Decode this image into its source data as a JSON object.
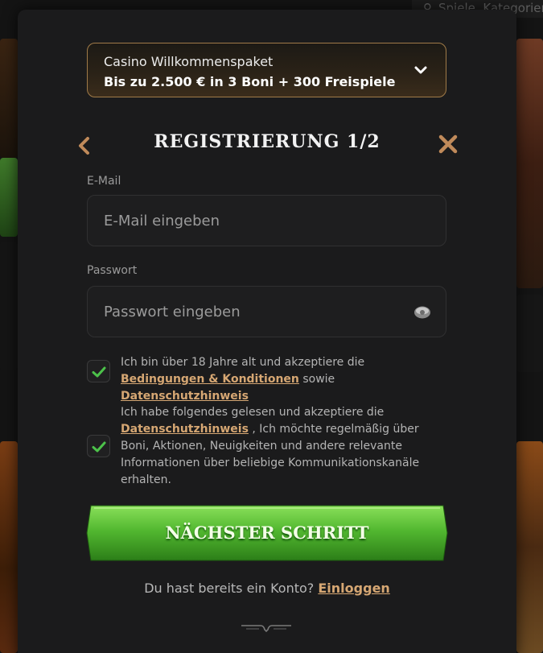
{
  "background": {
    "search_text": "Spiele, Kategorien"
  },
  "promo": {
    "line1": "Casino Willkommenspaket",
    "line2": "Bis zu 2.500 € in 3 Boni + 300 Freispiele",
    "icon": "chevron-down-icon"
  },
  "header": {
    "title": "REGISTRIERUNG 1/2",
    "back_icon": "chevron-left-icon",
    "close_icon": "close-icon"
  },
  "email": {
    "label": "E-Mail",
    "value": "",
    "placeholder": "E-Mail eingeben"
  },
  "password": {
    "label": "Passwort",
    "value": "",
    "placeholder": "Passwort eingeben",
    "icon": "eye-icon"
  },
  "consents": [
    {
      "checked": true,
      "text_before": "Ich bin über 18 Jahre alt und akzeptiere die",
      "link1": "Bedingungen & Konditionen",
      "middle": "sowie",
      "link2": "Datenschutzhinweis"
    },
    {
      "checked": true,
      "text_before": "Ich habe folgendes gelesen und akzeptiere die",
      "link1": "Datenschutzhinweis",
      "text_after": ", Ich möchte regelmäßig über Boni, Aktionen, Neuigkeiten und andere relevante Informationen über beliebige Kommunikationskanäle erhalten."
    }
  ],
  "next_button": {
    "label": "NÄCHSTER SCHRITT"
  },
  "login": {
    "prompt": "Du hast bereits ein Konto?",
    "link": "Einloggen"
  },
  "colors": {
    "accent_gold": "#d6a773",
    "button_green": "#4caf2a",
    "check_green": "#4cc24a",
    "modal_bg": "#1b1b1c"
  }
}
